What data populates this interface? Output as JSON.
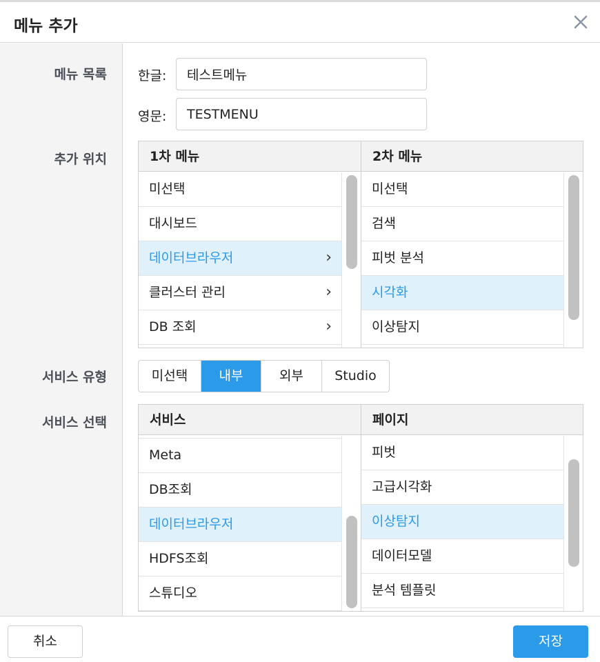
{
  "dialog": {
    "title": "메뉴 추가"
  },
  "labels": {
    "menu_list": "메뉴 목록",
    "position": "추가 위치",
    "service_type": "서비스 유형",
    "service_select": "서비스 선택"
  },
  "menu_name": {
    "korean_label": "한글:",
    "korean_value": "테스트메뉴",
    "english_label": "영문:",
    "english_value": "TESTMENU"
  },
  "position": {
    "first_header": "1차 메뉴",
    "second_header": "2차 메뉴",
    "first_items": [
      {
        "label": "미선택"
      },
      {
        "label": "대시보드"
      },
      {
        "label": "데이터브라우저",
        "chevron": "›"
      },
      {
        "label": "클러스터 관리",
        "chevron": "›"
      },
      {
        "label": "DB 조회",
        "chevron": "›"
      }
    ],
    "first_selected": "데이터브라우저",
    "second_items": [
      {
        "label": "미선택"
      },
      {
        "label": "검색"
      },
      {
        "label": "피벗 분석"
      },
      {
        "label": "시각화"
      },
      {
        "label": "이상탐지"
      }
    ],
    "second_selected": "시각화"
  },
  "service_type": {
    "options": [
      "미선택",
      "내부",
      "외부",
      "Studio"
    ],
    "selected": "내부"
  },
  "service_select": {
    "service_header": "서비스",
    "page_header": "페이지",
    "services": [
      "Meta",
      "DB조회",
      "데이터브라우저",
      "HDFS조회",
      "스튜디오"
    ],
    "service_selected": "데이터브라우저",
    "pages": [
      "피벗",
      "고급시각화",
      "이상탐지",
      "데이터모델",
      "분석 템플릿"
    ],
    "page_selected": "이상탐지"
  },
  "footer": {
    "cancel_label": "취소",
    "save_label": "저장"
  },
  "colors": {
    "accent": "#2b9ae9",
    "selected_row": "#e1f1fb",
    "label_bg": "#f4f4f5"
  },
  "icons": {
    "close": "close-icon",
    "chevron": "chevron-right-icon"
  }
}
